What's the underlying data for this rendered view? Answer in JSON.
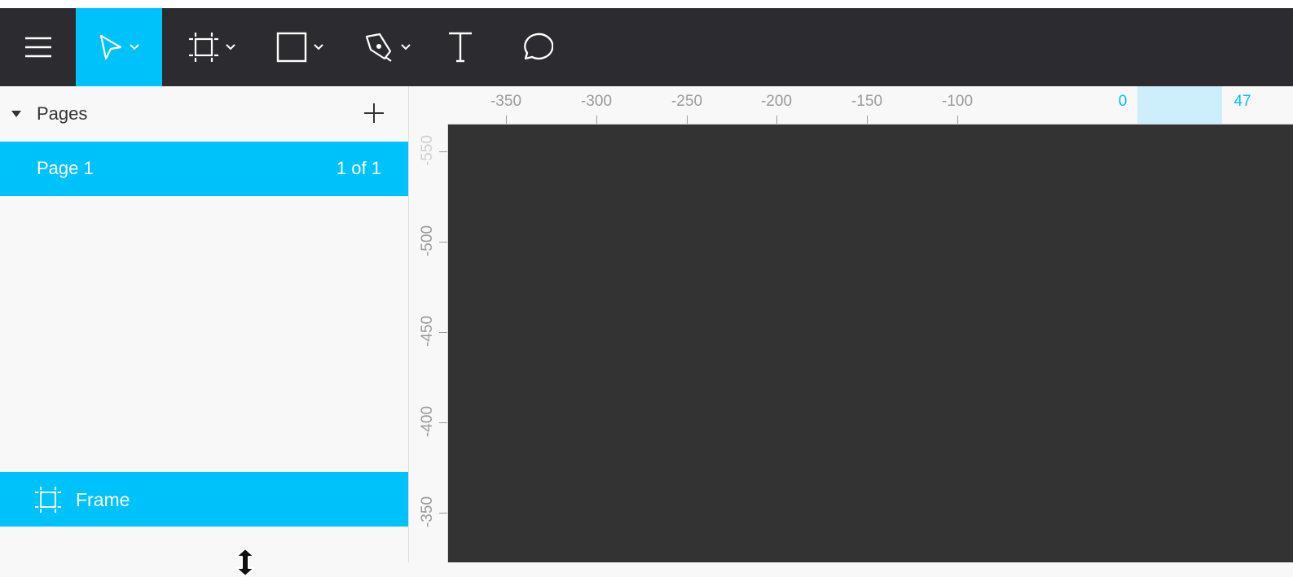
{
  "toolbar": {
    "tools": [
      {
        "name": "menu",
        "icon": "hamburger-menu-icon"
      },
      {
        "name": "move",
        "icon": "pointer-arrow-icon",
        "active": true,
        "has_dropdown": true
      },
      {
        "name": "frame",
        "icon": "frame-icon",
        "has_dropdown": true
      },
      {
        "name": "shape",
        "icon": "rectangle-icon",
        "has_dropdown": true
      },
      {
        "name": "pen",
        "icon": "pen-nib-icon",
        "has_dropdown": true
      },
      {
        "name": "text",
        "icon": "text-t-icon"
      },
      {
        "name": "comment",
        "icon": "speech-bubble-icon"
      }
    ],
    "active_color": "#00c2fa",
    "background": "#2c2c30"
  },
  "pages": {
    "title": "Pages",
    "items": [
      {
        "label": "Page 1",
        "count": "1 of 1",
        "selected": true
      }
    ]
  },
  "layers": {
    "items": [
      {
        "label": "Frame",
        "icon": "frame-icon",
        "selected": true
      }
    ]
  },
  "rulers": {
    "horizontal": {
      "labels": [
        "-350",
        "-300",
        "-250",
        "-200",
        "-150",
        "-100"
      ],
      "selection_start": "0",
      "selection_end": "47"
    },
    "vertical": {
      "labels": [
        "-550",
        "-500",
        "-450",
        "-400",
        "-350"
      ]
    }
  },
  "colors": {
    "accent": "#00c2fa",
    "canvas": "#333333",
    "panel": "#f8f8f8"
  }
}
